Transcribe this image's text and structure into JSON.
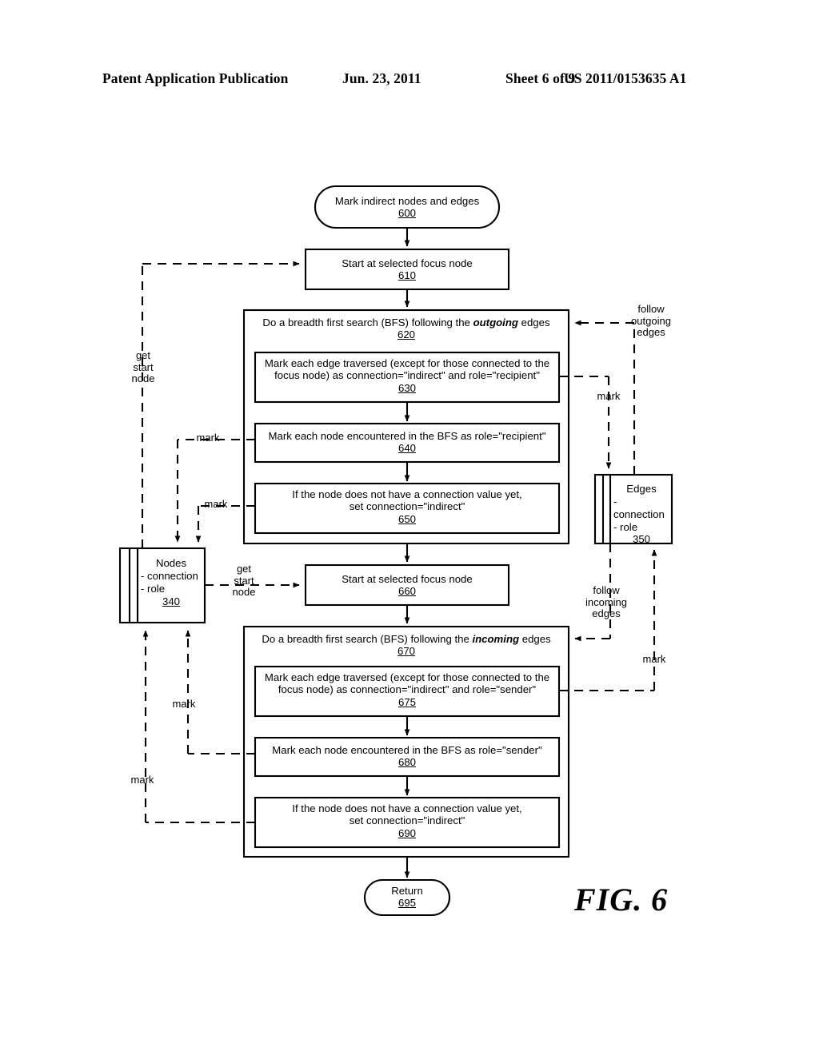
{
  "header": {
    "publication": "Patent Application Publication",
    "date": "Jun. 23, 2011",
    "sheet": "Sheet 6 of 9",
    "number": "US 2011/0153635 A1"
  },
  "figure": {
    "label": "FIG. 6"
  },
  "flow": {
    "start": {
      "text": "Mark indirect nodes and edges",
      "num": "600"
    },
    "step610": {
      "text": "Start at selected focus node",
      "num": "610"
    },
    "group620": {
      "text_pre": "Do a breadth first search (BFS) following the ",
      "text_em": "outgoing",
      "text_post": " edges",
      "num": "620"
    },
    "step630": {
      "line1": "Mark each edge traversed (except for those connected to the",
      "line2": "focus node) as connection=\"indirect\" and role=\"recipient\"",
      "num": "630"
    },
    "step640": {
      "text": "Mark each node encountered in the BFS as role=\"recipient\"",
      "num": "640"
    },
    "step650": {
      "line1": "If the node does not have a connection value yet,",
      "line2": "set connection=\"indirect\"",
      "num": "650"
    },
    "step660": {
      "text": "Start at selected focus node",
      "num": "660"
    },
    "group670": {
      "text_pre": "Do a breadth first search (BFS) following the ",
      "text_em": "incoming",
      "text_post": " edges",
      "num": "670"
    },
    "step675": {
      "line1": "Mark each edge traversed (except for those connected to the",
      "line2": "focus node) as connection=\"indirect\" and role=\"sender\"",
      "num": "675"
    },
    "step680": {
      "text": "Mark each node encountered in the BFS as role=\"sender\"",
      "num": "680"
    },
    "step690": {
      "line1": "If the node does not have a connection value yet,",
      "line2": "set connection=\"indirect\"",
      "num": "690"
    },
    "end": {
      "text": "Return",
      "num": "695"
    }
  },
  "stores": {
    "nodes": {
      "title": "Nodes",
      "attr1": "- connection",
      "attr2": "- role",
      "num": "340"
    },
    "edges": {
      "title": "Edges",
      "attr1": "- connection",
      "attr2": "- role",
      "num": "350"
    }
  },
  "annotations": {
    "get_start_node_left": "get\nstart\nnode",
    "get_start_node_mid": "get\nstart\nnode",
    "follow_outgoing_edges": "follow\noutgoing\nedges",
    "follow_incoming_edges": "follow\nincoming\nedges",
    "mark_640": "mark",
    "mark_650": "mark",
    "mark_680": "mark",
    "mark_690": "mark",
    "mark_630": "mark",
    "mark_675": "mark"
  },
  "colors": {
    "line": "#000000",
    "background": "#ffffff"
  }
}
